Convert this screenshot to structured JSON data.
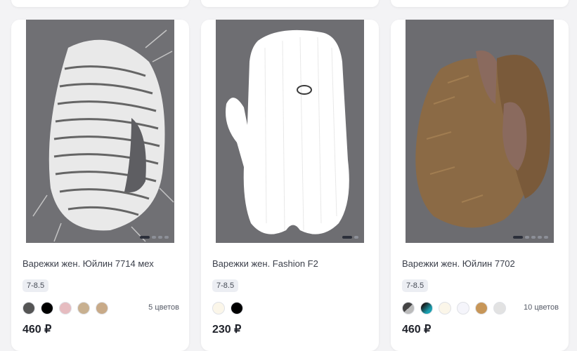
{
  "products": [
    {
      "title": "Варежки жен. Юйлин 7714 мех",
      "size": "7-8.5",
      "colors": [
        "#555555",
        "#000000",
        "#e6bcc0",
        "#c8b090",
        "#c8aa88"
      ],
      "color_count": "5 цветов",
      "price": "460 ₽"
    },
    {
      "title": "Варежки жен. Fashion F2",
      "size": "7-8.5",
      "colors": [
        "#fbf6e9",
        "#000000"
      ],
      "color_count": "",
      "price": "230 ₽"
    },
    {
      "title": "Варежки жен. Юйлин 7702",
      "size": "7-8.5",
      "colors": [
        "#6a6a6a",
        "#167a8a",
        "#fbf6e9",
        "#f5f5fb",
        "#c79658",
        "#e2e2e2"
      ],
      "color_count": "10 цветов",
      "price": "460 ₽"
    }
  ]
}
